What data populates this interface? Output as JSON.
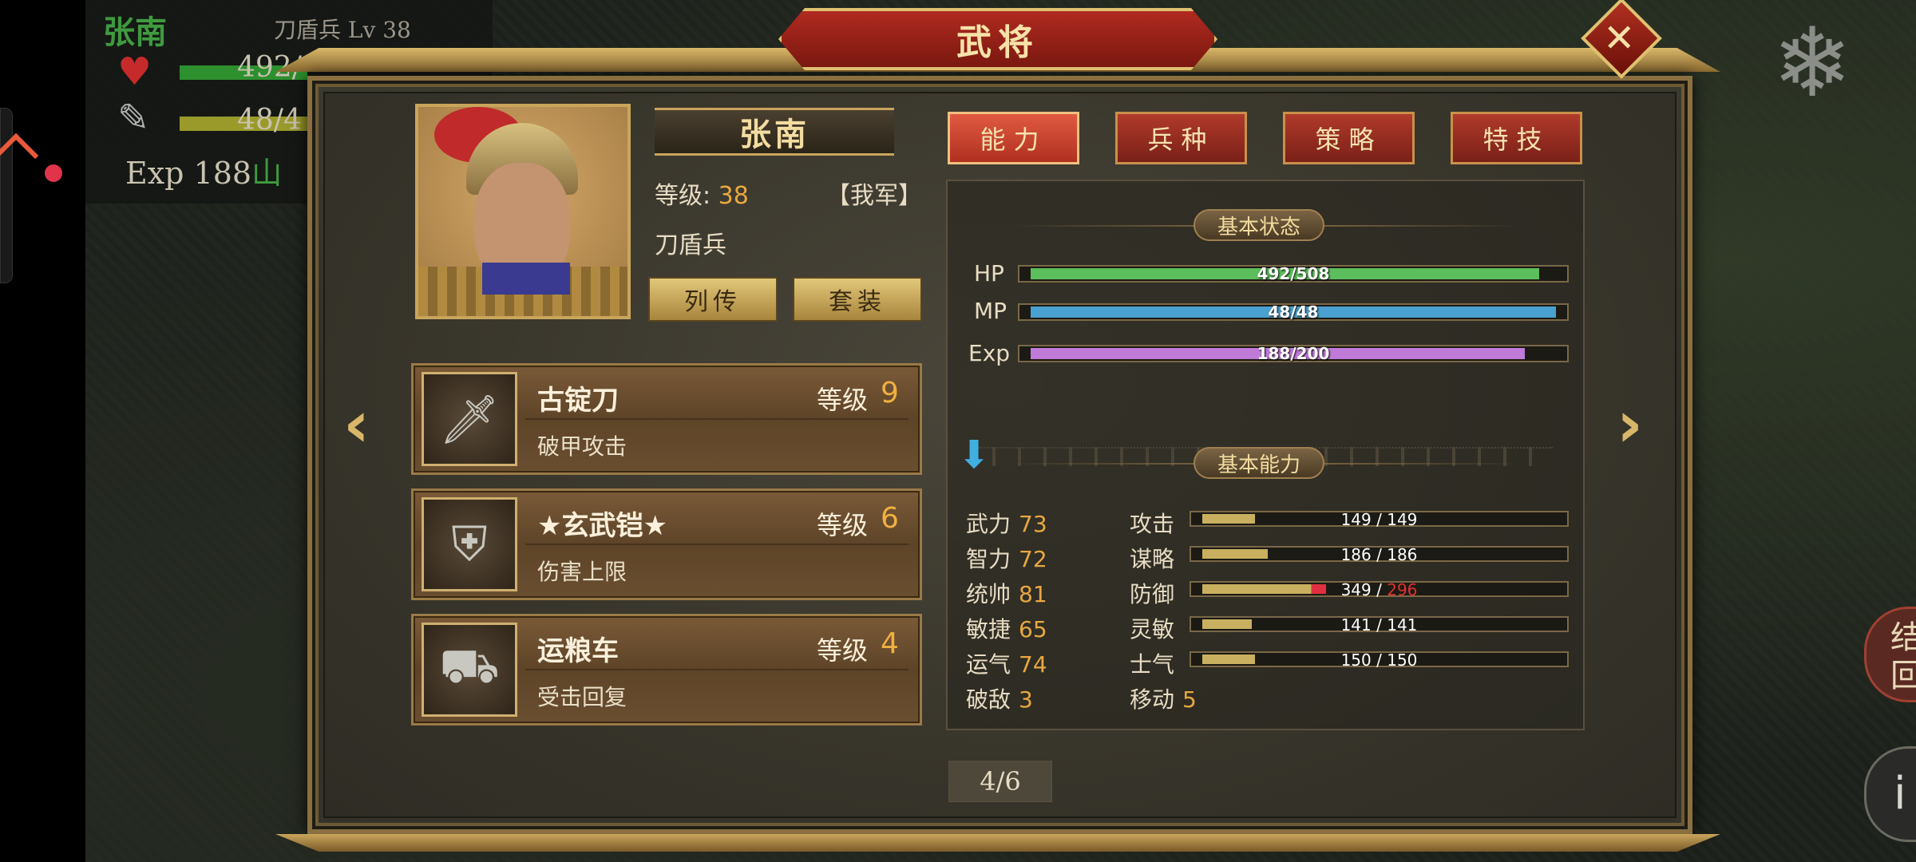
{
  "background_hud": {
    "unit_name": "张南",
    "unit_class": "刀盾兵",
    "unit_level_label": "Lv 38",
    "hp_partial": "492/",
    "mp_partial": "48/4",
    "exp_line_prefix": "Exp 188",
    "terrain": "山"
  },
  "right_buttons": {
    "settle_label": "结\n回",
    "info_label": "i"
  },
  "dialog": {
    "title": "武将",
    "close_glyph": "✕"
  },
  "general": {
    "name": "张南",
    "level_label": "等级:",
    "level_value": "38",
    "faction": "【我军】",
    "unit_type": "刀盾兵",
    "biography_button": "列传",
    "set_button": "套装"
  },
  "equipment": [
    {
      "name": "古锭刀",
      "level_label": "等级",
      "level": "9",
      "effect": "破甲攻击",
      "icon": "sword-icon"
    },
    {
      "name": "★玄武铠★",
      "level_label": "等级",
      "level": "6",
      "effect": "伤害上限",
      "icon": "armor-icon"
    },
    {
      "name": "运粮车",
      "level_label": "等级",
      "level": "4",
      "effect": "受击回复",
      "icon": "cart-icon"
    }
  ],
  "tabs": [
    {
      "label": "能力",
      "active": true
    },
    {
      "label": "兵种",
      "active": false
    },
    {
      "label": "策略",
      "active": false
    },
    {
      "label": "特技",
      "active": false
    }
  ],
  "basic_status": {
    "section_title": "基本状态",
    "bars": [
      {
        "label": "HP",
        "current": 492,
        "max": 508,
        "text": "492/508",
        "color": "#5cbe5c"
      },
      {
        "label": "MP",
        "current": 48,
        "max": 48,
        "text": "48/48",
        "color": "#4aa0d0"
      },
      {
        "label": "Exp",
        "current": 188,
        "max": 200,
        "text": "188/200",
        "color": "#c07ad8"
      }
    ]
  },
  "basic_ability": {
    "section_title": "基本能力",
    "attributes": [
      {
        "name": "武力",
        "value": "73"
      },
      {
        "name": "智力",
        "value": "72"
      },
      {
        "name": "统帅",
        "value": "81"
      },
      {
        "name": "敏捷",
        "value": "65"
      },
      {
        "name": "运气",
        "value": "74"
      },
      {
        "name": "破敌",
        "value": "3"
      }
    ],
    "combat_stats": [
      {
        "name": "攻击",
        "current": "149",
        "max": "149",
        "fill": 0.149,
        "over": false
      },
      {
        "name": "谋略",
        "current": "186",
        "max": "186",
        "fill": 0.186,
        "over": false
      },
      {
        "name": "防御",
        "current": "349",
        "max": "296",
        "fill": 0.349,
        "over": true
      },
      {
        "name": "灵敏",
        "current": "141",
        "max": "141",
        "fill": 0.141,
        "over": false
      },
      {
        "name": "士气",
        "current": "150",
        "max": "150",
        "fill": 0.15,
        "over": false
      }
    ],
    "move_label": "移动",
    "move_value": "5"
  },
  "pagination": {
    "text": "4/6"
  },
  "colors": {
    "accent_red": "#b02a20",
    "gold": "#c9a55c",
    "level_orange": "#e8a840"
  }
}
